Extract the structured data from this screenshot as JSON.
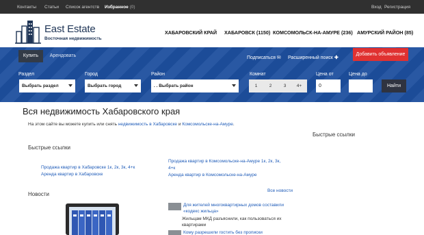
{
  "topbar": {
    "contacts": "Контакты",
    "articles": "Статьи",
    "agencies": "Список агентств",
    "favorites_label": "Избранное",
    "favorites_count": "(0)",
    "login": "Вход",
    "register": "Регистрация"
  },
  "logo": {
    "title": "East Estate",
    "subtitle": "Восточная недвижимость"
  },
  "regions": [
    "ХАБАРОВСКИЙ КРАЙ",
    "ХАБАРОВСК (1150)",
    "КОМСОМОЛЬСК-НА-АМУРЕ (236)",
    "АМУРСКИЙ РАЙОН (85)"
  ],
  "search": {
    "tab_buy": "Купить",
    "tab_rent": "Арендовать",
    "subscribe": "Подписаться",
    "advanced": "Расширенный поиск",
    "add_listing": "Добавить объявление",
    "section_label": "Раздел",
    "section_value": "Выбрать раздел",
    "city_label": "Город",
    "city_value": "Выбрать город",
    "district_label": "Район",
    "district_value": ". . Выбрать район",
    "rooms_label": "Комнат",
    "rooms": [
      "1",
      "2",
      "3",
      "4+"
    ],
    "price_from_label": "Цена от",
    "price_from_value": "0",
    "price_to_label": "Цена до",
    "price_to_value": "",
    "find": "Найти"
  },
  "main": {
    "title": "Вся недвижимость Хабаровского края",
    "intro_text": "На этом сайте вы можете купить или снять",
    "intro_link1": "недвижимость в Хабаровске",
    "intro_and": "и",
    "intro_link2": "Комсомольске-на-Амуре",
    "intro_end": ".",
    "quick_links_title": "Быстрые ссылки",
    "quick_links_side_title": "Быстрые ссылки",
    "quick_links": {
      "khv_sale": "Продажа квартир в Хабаровске 1к, 2к, 3к, 4+к",
      "khv_rent": "Аренда квартир в Хабаровске",
      "kms_sale_1": "Продажа квартир в Комсомольске-на-Амуре 1к, 2к, 3к,",
      "kms_sale_2": "4+к",
      "kms_rent": "Аренда квартир в Комсомольске-на-Амуре"
    },
    "news_title": "Новости",
    "all_news": "Все новости",
    "news": [
      {
        "title_1": "Для жителей многоквартирных домов составили",
        "title_2": "«кодекс жильца»",
        "text_1": "Жильцам МКД разъяснили, как пользоваться их",
        "text_2": "квартирами"
      },
      {
        "title_1": "Кому разрешили гостить без прописки"
      }
    ]
  },
  "icons": {
    "subscribe": "mail-icon",
    "advanced": "plus-icon",
    "logo": "building-icon"
  }
}
